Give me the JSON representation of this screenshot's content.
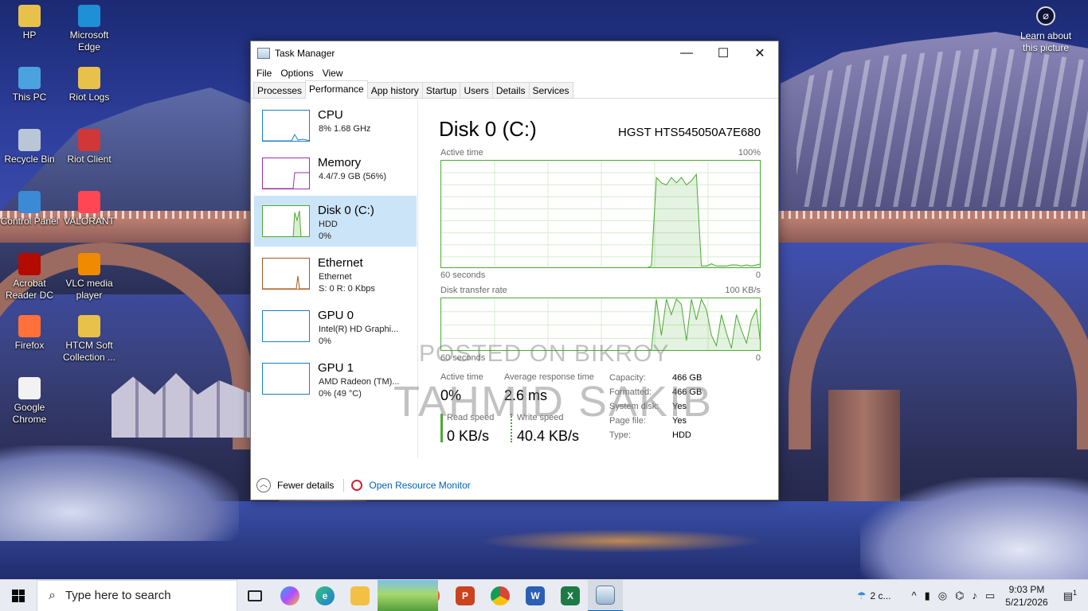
{
  "desktop": {
    "icons": [
      {
        "label": "HP",
        "icon": "folder-icon",
        "color": "#e8c14a"
      },
      {
        "label": "Microsoft Edge",
        "icon": "edge-icon",
        "color": "#1f8fd6"
      },
      {
        "label": "This PC",
        "icon": "computer-icon",
        "color": "#4aa3df"
      },
      {
        "label": "Riot Logs",
        "icon": "folder-icon",
        "color": "#e8c14a"
      },
      {
        "label": "Recycle Bin",
        "icon": "recycle-bin-icon",
        "color": "#b9c6d6"
      },
      {
        "label": "Riot Client",
        "icon": "riot-client-icon",
        "color": "#d13639"
      },
      {
        "label": "Control Panel",
        "icon": "control-panel-icon",
        "color": "#3a8ad6"
      },
      {
        "label": "VALORANT",
        "icon": "valorant-icon",
        "color": "#ff4655"
      },
      {
        "label": "Acrobat Reader DC",
        "icon": "acrobat-icon",
        "color": "#b30b00"
      },
      {
        "label": "VLC media player",
        "icon": "vlc-icon",
        "color": "#f08a00"
      },
      {
        "label": "Firefox",
        "icon": "firefox-icon",
        "color": "#ff7139"
      },
      {
        "label": "HTCM Soft Collection ...",
        "icon": "folder-icon",
        "color": "#e8c14a"
      },
      {
        "label": "Google Chrome",
        "icon": "document-icon",
        "color": "#f2f2f2"
      }
    ],
    "learn_about": "Learn about this picture"
  },
  "window": {
    "title": "Task Manager",
    "controls": {
      "minimize": "—",
      "maximize": "☐",
      "close": "✕"
    },
    "menu": [
      "File",
      "Options",
      "View"
    ],
    "tabs": [
      "Processes",
      "Performance",
      "App history",
      "Startup",
      "Users",
      "Details",
      "Services"
    ],
    "active_tab": "Performance"
  },
  "resources": [
    {
      "name": "CPU",
      "line1": "8%  1.68 GHz",
      "line2": "",
      "color": "#1a7fc0"
    },
    {
      "name": "Memory",
      "line1": "4.4/7.9 GB (56%)",
      "line2": "",
      "color": "#9a2fa3"
    },
    {
      "name": "Disk 0 (C:)",
      "line1": "HDD",
      "line2": "0%",
      "color": "#4da934"
    },
    {
      "name": "Ethernet",
      "line1": "Ethernet",
      "line2": "S: 0  R: 0 Kbps",
      "color": "#a5591b"
    },
    {
      "name": "GPU 0",
      "line1": "Intel(R) HD Graphi...",
      "line2": "0%",
      "color": "#1a7fc0"
    },
    {
      "name": "GPU 1",
      "line1": "AMD Radeon (TM)...",
      "line2": "0% (49 °C)",
      "color": "#1a7fc0"
    }
  ],
  "detail": {
    "title": "Disk 0 (C:)",
    "model": "HGST HTS545050A7E680",
    "graph1": {
      "label": "Active time",
      "max": "100%",
      "time": "60 seconds",
      "min": "0"
    },
    "graph2": {
      "label": "Disk transfer rate",
      "max": "100 KB/s",
      "time": "60 seconds",
      "min": "0"
    },
    "stats": {
      "active_time_label": "Active time",
      "active_time": "0%",
      "response_label": "Average response time",
      "response": "2.6 ms",
      "read_label": "Read speed",
      "read": "0 KB/s",
      "write_label": "Write speed",
      "write": "40.4 KB/s"
    },
    "properties": [
      {
        "key": "Capacity:",
        "value": "466 GB"
      },
      {
        "key": "Formatted:",
        "value": "466 GB"
      },
      {
        "key": "System disk:",
        "value": "Yes"
      },
      {
        "key": "Page file:",
        "value": "Yes"
      },
      {
        "key": "Type:",
        "value": "HDD"
      }
    ]
  },
  "footer": {
    "fewer": "Fewer details",
    "resmon": "Open Resource Monitor"
  },
  "watermark": {
    "line1": "POSTED ON BIKROY",
    "line2": "TAHMID SAKIB"
  },
  "taskbar": {
    "search_placeholder": "Type here to search",
    "weather": "2 c...",
    "time": "9:03 PM",
    "date": "5/21/2026",
    "notification_count": "1"
  },
  "charts": {
    "active_time_series": [
      0,
      0,
      0,
      0,
      0,
      0,
      0,
      0,
      0,
      0,
      0,
      0,
      0,
      0,
      0,
      0,
      0,
      0,
      0,
      0,
      0,
      0,
      0,
      0,
      0,
      0,
      0,
      0,
      0,
      0,
      0,
      0,
      0,
      0,
      0,
      0,
      0,
      0,
      0,
      0,
      0,
      0,
      2,
      85,
      80,
      78,
      85,
      80,
      85,
      78,
      82,
      88,
      2,
      2,
      4,
      2,
      2,
      2,
      3,
      3,
      2,
      3,
      2,
      3,
      4
    ],
    "transfer_series": [
      0,
      0,
      0,
      0,
      0,
      0,
      0,
      0,
      0,
      0,
      0,
      0,
      0,
      0,
      0,
      0,
      0,
      0,
      0,
      0,
      0,
      0,
      0,
      0,
      0,
      0,
      0,
      0,
      0,
      0,
      0,
      0,
      0,
      0,
      0,
      0,
      0,
      0,
      0,
      0,
      0,
      0,
      2,
      100,
      30,
      100,
      70,
      100,
      90,
      20,
      100,
      60,
      100,
      80,
      30,
      10,
      70,
      35,
      5,
      70,
      40,
      15,
      60,
      80,
      0
    ]
  }
}
